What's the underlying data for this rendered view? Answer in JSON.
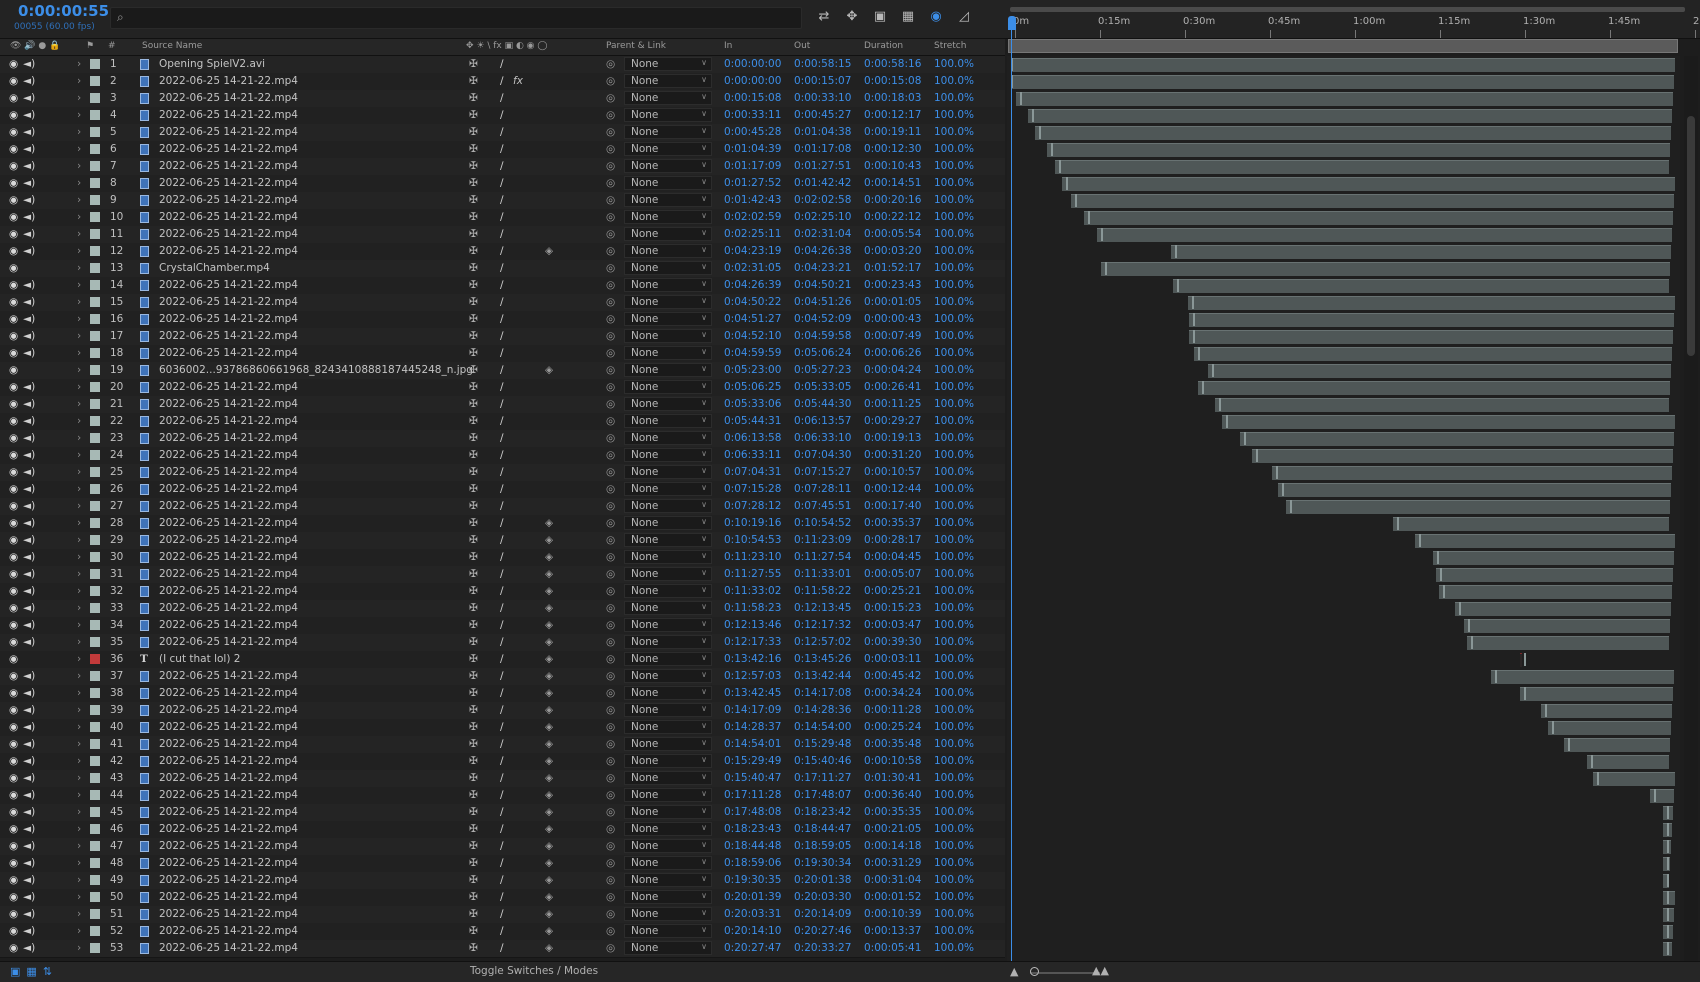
{
  "header": {
    "current_time": "0:00:00:55",
    "frame_info": "00055 (60.00 fps)",
    "search_placeholder": "",
    "search_icon": "search-icon"
  },
  "toolbar": {
    "icons": [
      "composition-mini-flowchart-icon",
      "draft-3d-icon",
      "shy-icon",
      "frame-blending-icon",
      "motion-blur-icon",
      "graph-editor-icon"
    ]
  },
  "ruler": {
    "ticks": [
      "0m",
      "0:15m",
      "0:30m",
      "0:45m",
      "1:00m",
      "1:15m",
      "1:30m",
      "1:45m",
      "2"
    ]
  },
  "columns": {
    "source_name": "Source Name",
    "number": "#",
    "parent_link": "Parent & Link",
    "in": "In",
    "out": "Out",
    "duration": "Duration",
    "stretch": "Stretch"
  },
  "colors": {
    "accent_blue": "#3c8ee8",
    "label_aqua": "#a7b9b5",
    "label_red": "#c23a3a"
  },
  "layers": [
    {
      "n": "1",
      "name": "Opening SpielV2.avi",
      "in": "0:00:00:00",
      "out": "0:00:58:15",
      "dur": "0:00:58:16",
      "stretch": "100.0%",
      "type": "file",
      "audio": true,
      "fx": false
    },
    {
      "n": "2",
      "name": "2022-06-25 14-21-22.mp4",
      "in": "0:00:00:00",
      "out": "0:00:15:07",
      "dur": "0:00:15:08",
      "stretch": "100.0%",
      "type": "file",
      "audio": true,
      "fx": true
    },
    {
      "n": "3",
      "name": "2022-06-25 14-21-22.mp4",
      "in": "0:00:15:08",
      "out": "0:00:33:10",
      "dur": "0:00:18:03",
      "stretch": "100.0%",
      "type": "file",
      "audio": true
    },
    {
      "n": "4",
      "name": "2022-06-25 14-21-22.mp4",
      "in": "0:00:33:11",
      "out": "0:00:45:27",
      "dur": "0:00:12:17",
      "stretch": "100.0%",
      "type": "file",
      "audio": true
    },
    {
      "n": "5",
      "name": "2022-06-25 14-21-22.mp4",
      "in": "0:00:45:28",
      "out": "0:01:04:38",
      "dur": "0:00:19:11",
      "stretch": "100.0%",
      "type": "file",
      "audio": true
    },
    {
      "n": "6",
      "name": "2022-06-25 14-21-22.mp4",
      "in": "0:01:04:39",
      "out": "0:01:17:08",
      "dur": "0:00:12:30",
      "stretch": "100.0%",
      "type": "file",
      "audio": true
    },
    {
      "n": "7",
      "name": "2022-06-25 14-21-22.mp4",
      "in": "0:01:17:09",
      "out": "0:01:27:51",
      "dur": "0:00:10:43",
      "stretch": "100.0%",
      "type": "file",
      "audio": true
    },
    {
      "n": "8",
      "name": "2022-06-25 14-21-22.mp4",
      "in": "0:01:27:52",
      "out": "0:01:42:42",
      "dur": "0:00:14:51",
      "stretch": "100.0%",
      "type": "file",
      "audio": true
    },
    {
      "n": "9",
      "name": "2022-06-25 14-21-22.mp4",
      "in": "0:01:42:43",
      "out": "0:02:02:58",
      "dur": "0:00:20:16",
      "stretch": "100.0%",
      "type": "file",
      "audio": true
    },
    {
      "n": "10",
      "name": "2022-06-25 14-21-22.mp4",
      "in": "0:02:02:59",
      "out": "0:02:25:10",
      "dur": "0:00:22:12",
      "stretch": "100.0%",
      "type": "file",
      "audio": true
    },
    {
      "n": "11",
      "name": "2022-06-25 14-21-22.mp4",
      "in": "0:02:25:11",
      "out": "0:02:31:04",
      "dur": "0:00:05:54",
      "stretch": "100.0%",
      "type": "file",
      "audio": true
    },
    {
      "n": "12",
      "name": "2022-06-25 14-21-22.mp4",
      "in": "0:04:23:19",
      "out": "0:04:26:38",
      "dur": "0:00:03:20",
      "stretch": "100.0%",
      "type": "file",
      "audio": true,
      "motion": true
    },
    {
      "n": "13",
      "name": "CrystalChamber.mp4",
      "in": "0:02:31:05",
      "out": "0:04:23:21",
      "dur": "0:01:52:17",
      "stretch": "100.0%",
      "type": "file",
      "audio": false
    },
    {
      "n": "14",
      "name": "2022-06-25 14-21-22.mp4",
      "in": "0:04:26:39",
      "out": "0:04:50:21",
      "dur": "0:00:23:43",
      "stretch": "100.0%",
      "type": "file",
      "audio": true
    },
    {
      "n": "15",
      "name": "2022-06-25 14-21-22.mp4",
      "in": "0:04:50:22",
      "out": "0:04:51:26",
      "dur": "0:00:01:05",
      "stretch": "100.0%",
      "type": "file",
      "audio": true
    },
    {
      "n": "16",
      "name": "2022-06-25 14-21-22.mp4",
      "in": "0:04:51:27",
      "out": "0:04:52:09",
      "dur": "0:00:00:43",
      "stretch": "100.0%",
      "type": "file",
      "audio": true
    },
    {
      "n": "17",
      "name": "2022-06-25 14-21-22.mp4",
      "in": "0:04:52:10",
      "out": "0:04:59:58",
      "dur": "0:00:07:49",
      "stretch": "100.0%",
      "type": "file",
      "audio": true
    },
    {
      "n": "18",
      "name": "2022-06-25 14-21-22.mp4",
      "in": "0:04:59:59",
      "out": "0:05:06:24",
      "dur": "0:00:06:26",
      "stretch": "100.0%",
      "type": "file",
      "audio": true
    },
    {
      "n": "19",
      "name": "6036002...93786860661968_8243410888187445248_n.jpg",
      "in": "0:05:23:00",
      "out": "0:05:27:23",
      "dur": "0:00:04:24",
      "stretch": "100.0%",
      "type": "file",
      "audio": false,
      "motion": true
    },
    {
      "n": "20",
      "name": "2022-06-25 14-21-22.mp4",
      "in": "0:05:06:25",
      "out": "0:05:33:05",
      "dur": "0:00:26:41",
      "stretch": "100.0%",
      "type": "file",
      "audio": true
    },
    {
      "n": "21",
      "name": "2022-06-25 14-21-22.mp4",
      "in": "0:05:33:06",
      "out": "0:05:44:30",
      "dur": "0:00:11:25",
      "stretch": "100.0%",
      "type": "file",
      "audio": true
    },
    {
      "n": "22",
      "name": "2022-06-25 14-21-22.mp4",
      "in": "0:05:44:31",
      "out": "0:06:13:57",
      "dur": "0:00:29:27",
      "stretch": "100.0%",
      "type": "file",
      "audio": true
    },
    {
      "n": "23",
      "name": "2022-06-25 14-21-22.mp4",
      "in": "0:06:13:58",
      "out": "0:06:33:10",
      "dur": "0:00:19:13",
      "stretch": "100.0%",
      "type": "file",
      "audio": true
    },
    {
      "n": "24",
      "name": "2022-06-25 14-21-22.mp4",
      "in": "0:06:33:11",
      "out": "0:07:04:30",
      "dur": "0:00:31:20",
      "stretch": "100.0%",
      "type": "file",
      "audio": true
    },
    {
      "n": "25",
      "name": "2022-06-25 14-21-22.mp4",
      "in": "0:07:04:31",
      "out": "0:07:15:27",
      "dur": "0:00:10:57",
      "stretch": "100.0%",
      "type": "file",
      "audio": true
    },
    {
      "n": "26",
      "name": "2022-06-25 14-21-22.mp4",
      "in": "0:07:15:28",
      "out": "0:07:28:11",
      "dur": "0:00:12:44",
      "stretch": "100.0%",
      "type": "file",
      "audio": true
    },
    {
      "n": "27",
      "name": "2022-06-25 14-21-22.mp4",
      "in": "0:07:28:12",
      "out": "0:07:45:51",
      "dur": "0:00:17:40",
      "stretch": "100.0%",
      "type": "file",
      "audio": true
    },
    {
      "n": "28",
      "name": "2022-06-25 14-21-22.mp4",
      "in": "0:10:19:16",
      "out": "0:10:54:52",
      "dur": "0:00:35:37",
      "stretch": "100.0%",
      "type": "file",
      "audio": true,
      "motion": true
    },
    {
      "n": "29",
      "name": "2022-06-25 14-21-22.mp4",
      "in": "0:10:54:53",
      "out": "0:11:23:09",
      "dur": "0:00:28:17",
      "stretch": "100.0%",
      "type": "file",
      "audio": true,
      "motion": true
    },
    {
      "n": "30",
      "name": "2022-06-25 14-21-22.mp4",
      "in": "0:11:23:10",
      "out": "0:11:27:54",
      "dur": "0:00:04:45",
      "stretch": "100.0%",
      "type": "file",
      "audio": true,
      "motion": true
    },
    {
      "n": "31",
      "name": "2022-06-25 14-21-22.mp4",
      "in": "0:11:27:55",
      "out": "0:11:33:01",
      "dur": "0:00:05:07",
      "stretch": "100.0%",
      "type": "file",
      "audio": true,
      "motion": true
    },
    {
      "n": "32",
      "name": "2022-06-25 14-21-22.mp4",
      "in": "0:11:33:02",
      "out": "0:11:58:22",
      "dur": "0:00:25:21",
      "stretch": "100.0%",
      "type": "file",
      "audio": true,
      "motion": true
    },
    {
      "n": "33",
      "name": "2022-06-25 14-21-22.mp4",
      "in": "0:11:58:23",
      "out": "0:12:13:45",
      "dur": "0:00:15:23",
      "stretch": "100.0%",
      "type": "file",
      "audio": true,
      "motion": true
    },
    {
      "n": "34",
      "name": "2022-06-25 14-21-22.mp4",
      "in": "0:12:13:46",
      "out": "0:12:17:32",
      "dur": "0:00:03:47",
      "stretch": "100.0%",
      "type": "file",
      "audio": true,
      "motion": true
    },
    {
      "n": "35",
      "name": "2022-06-25 14-21-22.mp4",
      "in": "0:12:17:33",
      "out": "0:12:57:02",
      "dur": "0:00:39:30",
      "stretch": "100.0%",
      "type": "file",
      "audio": true,
      "motion": true
    },
    {
      "n": "36",
      "name": "(I cut that lol) 2",
      "in": "0:13:42:16",
      "out": "0:13:45:26",
      "dur": "0:00:03:11",
      "stretch": "100.0%",
      "type": "text",
      "audio": false,
      "motion": true,
      "red": true
    },
    {
      "n": "37",
      "name": "2022-06-25 14-21-22.mp4",
      "in": "0:12:57:03",
      "out": "0:13:42:44",
      "dur": "0:00:45:42",
      "stretch": "100.0%",
      "type": "file",
      "audio": true,
      "motion": true
    },
    {
      "n": "38",
      "name": "2022-06-25 14-21-22.mp4",
      "in": "0:13:42:45",
      "out": "0:14:17:08",
      "dur": "0:00:34:24",
      "stretch": "100.0%",
      "type": "file",
      "audio": true,
      "motion": true
    },
    {
      "n": "39",
      "name": "2022-06-25 14-21-22.mp4",
      "in": "0:14:17:09",
      "out": "0:14:28:36",
      "dur": "0:00:11:28",
      "stretch": "100.0%",
      "type": "file",
      "audio": true,
      "motion": true
    },
    {
      "n": "40",
      "name": "2022-06-25 14-21-22.mp4",
      "in": "0:14:28:37",
      "out": "0:14:54:00",
      "dur": "0:00:25:24",
      "stretch": "100.0%",
      "type": "file",
      "audio": true,
      "motion": true
    },
    {
      "n": "41",
      "name": "2022-06-25 14-21-22.mp4",
      "in": "0:14:54:01",
      "out": "0:15:29:48",
      "dur": "0:00:35:48",
      "stretch": "100.0%",
      "type": "file",
      "audio": true,
      "motion": true
    },
    {
      "n": "42",
      "name": "2022-06-25 14-21-22.mp4",
      "in": "0:15:29:49",
      "out": "0:15:40:46",
      "dur": "0:00:10:58",
      "stretch": "100.0%",
      "type": "file",
      "audio": true,
      "motion": true
    },
    {
      "n": "43",
      "name": "2022-06-25 14-21-22.mp4",
      "in": "0:15:40:47",
      "out": "0:17:11:27",
      "dur": "0:01:30:41",
      "stretch": "100.0%",
      "type": "file",
      "audio": true,
      "motion": true
    },
    {
      "n": "44",
      "name": "2022-06-25 14-21-22.mp4",
      "in": "0:17:11:28",
      "out": "0:17:48:07",
      "dur": "0:00:36:40",
      "stretch": "100.0%",
      "type": "file",
      "audio": true,
      "motion": true
    },
    {
      "n": "45",
      "name": "2022-06-25 14-21-22.mp4",
      "in": "0:17:48:08",
      "out": "0:18:23:42",
      "dur": "0:00:35:35",
      "stretch": "100.0%",
      "type": "file",
      "audio": true,
      "motion": true
    },
    {
      "n": "46",
      "name": "2022-06-25 14-21-22.mp4",
      "in": "0:18:23:43",
      "out": "0:18:44:47",
      "dur": "0:00:21:05",
      "stretch": "100.0%",
      "type": "file",
      "audio": true,
      "motion": true
    },
    {
      "n": "47",
      "name": "2022-06-25 14-21-22.mp4",
      "in": "0:18:44:48",
      "out": "0:18:59:05",
      "dur": "0:00:14:18",
      "stretch": "100.0%",
      "type": "file",
      "audio": true,
      "motion": true
    },
    {
      "n": "48",
      "name": "2022-06-25 14-21-22.mp4",
      "in": "0:18:59:06",
      "out": "0:19:30:34",
      "dur": "0:00:31:29",
      "stretch": "100.0%",
      "type": "file",
      "audio": true,
      "motion": true
    },
    {
      "n": "49",
      "name": "2022-06-25 14-21-22.mp4",
      "in": "0:19:30:35",
      "out": "0:20:01:38",
      "dur": "0:00:31:04",
      "stretch": "100.0%",
      "type": "file",
      "audio": true,
      "motion": true
    },
    {
      "n": "50",
      "name": "2022-06-25 14-21-22.mp4",
      "in": "0:20:01:39",
      "out": "0:20:03:30",
      "dur": "0:00:01:52",
      "stretch": "100.0%",
      "type": "file",
      "audio": true,
      "motion": true
    },
    {
      "n": "51",
      "name": "2022-06-25 14-21-22.mp4",
      "in": "0:20:03:31",
      "out": "0:20:14:09",
      "dur": "0:00:10:39",
      "stretch": "100.0%",
      "type": "file",
      "audio": true,
      "motion": true
    },
    {
      "n": "52",
      "name": "2022-06-25 14-21-22.mp4",
      "in": "0:20:14:10",
      "out": "0:20:27:46",
      "dur": "0:00:13:37",
      "stretch": "100.0%",
      "type": "file",
      "audio": true,
      "motion": true
    },
    {
      "n": "53",
      "name": "2022-06-25 14-21-22.mp4",
      "in": "0:20:27:47",
      "out": "0:20:33:27",
      "dur": "0:00:05:41",
      "stretch": "100.0%",
      "type": "file",
      "audio": true,
      "motion": true
    }
  ],
  "parent_value": "None",
  "footer": {
    "toggle_label": "Toggle Switches / Modes"
  }
}
